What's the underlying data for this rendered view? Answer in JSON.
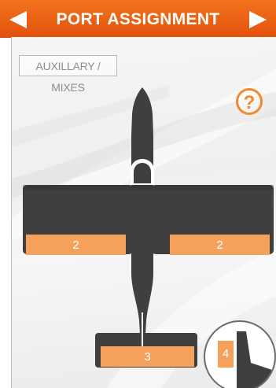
{
  "header": {
    "title": "PORT ASSIGNMENT",
    "prev_icon": "triangle-left-icon",
    "next_icon": "triangle-right-icon"
  },
  "mode_button": {
    "label": "AUXILLARY / MIXES"
  },
  "help": {
    "icon": "question-circle-icon",
    "label": "?"
  },
  "ports": {
    "left_wing": "2",
    "right_wing": "2",
    "elevator": "3",
    "rudder": "4"
  },
  "colors": {
    "header_orange": "#e95f12",
    "port_fill": "#f5a15b",
    "help_orange": "#f08a2a",
    "airplane": "#3f3f3f",
    "background": "#f0f0f0"
  }
}
